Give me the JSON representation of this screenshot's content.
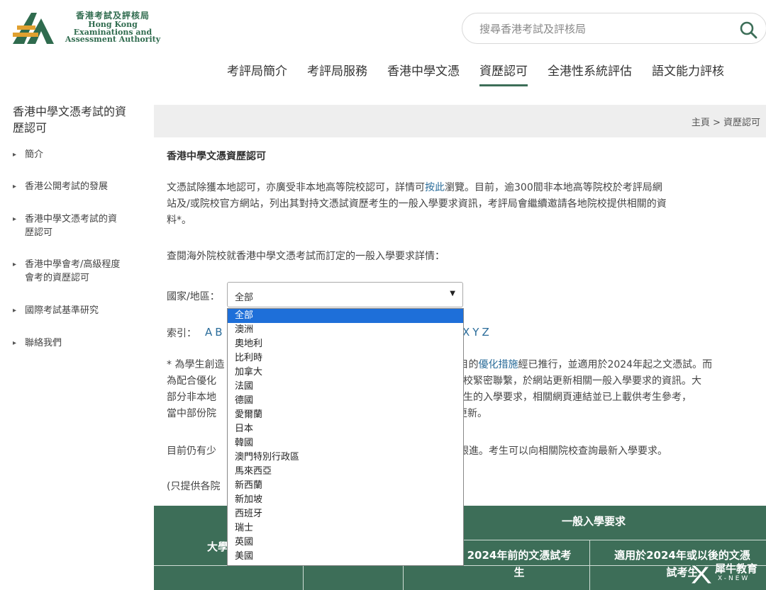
{
  "header": {
    "logo_zh": "香港考試及評核局",
    "logo_en_line1": "Hong Kong",
    "logo_en_line2": "Examinations and",
    "logo_en_line3": "Assessment Authority",
    "search_placeholder": "搜尋香港考試及評核局"
  },
  "nav": [
    {
      "label": "考評局簡介",
      "active": false
    },
    {
      "label": "考評局服務",
      "active": false
    },
    {
      "label": "香港中學文憑",
      "active": false
    },
    {
      "label": "資歷認可",
      "active": true
    },
    {
      "label": "全港性系統評估",
      "active": false
    },
    {
      "label": "語文能力評核",
      "active": false
    }
  ],
  "sidebar": {
    "title_line1": "香港中學文憑考試的資",
    "title_line2": "歷認可",
    "items": [
      {
        "line1": "簡介",
        "line2": ""
      },
      {
        "line1": "香港公開考試的發展",
        "line2": ""
      },
      {
        "line1": "香港中學文憑考試的資",
        "line2": "歷認可"
      },
      {
        "line1": "香港中學會考/高級程度",
        "line2": "會考的資歷認可"
      },
      {
        "line1": "國際考試基準研究",
        "line2": ""
      },
      {
        "line1": "聯絡我們",
        "line2": ""
      }
    ]
  },
  "breadcrumb": "主頁 > 資歷認可",
  "content": {
    "title": "香港中學文憑資歷認可",
    "p1_line1_a": "文憑試除獲本地認可，亦廣受非本地高等院校認可，詳情可",
    "p1_link": "按此",
    "p1_line1_b": "瀏覽。目前，逾300間非本地高等院校於考評局網",
    "p1_line2": "站及/或院校官方網站，列出其對持文憑試資歷考生的一般入學要求資訊，考評局會繼續邀請各地院校提供相關的資",
    "p1_line3": "料*。",
    "p2": "查閱海外院校就香港中學文憑考試而訂定的一般入學要求詳情：",
    "region_label": "國家/地區：",
    "select_value": "全部",
    "index_label": "索引：",
    "index_letters_left": "AB",
    "index_letters_right": "XYZ",
    "p3_line1_a": "* 為學生創造",
    "p3_line1_b": "目的",
    "p3_link": "優化措施",
    "p3_line1_c": "經已推行，並適用於2024年起之文憑試。而",
    "p3_line2_a": "為配合優化",
    "p3_line2_b": "院校緊密聯繫，於網站更新相關一般入學要求的資訊。大",
    "p3_line3_a": "部分非本地",
    "p3_line3_b": "試考生的入學要求，相關網頁連結並已上載供考生參考，",
    "p3_line4_a": "當中部份院",
    "p3_line4_b": "更新。",
    "p4_a": "目前仍有少",
    "p4_b": "續跟進。考生可以向相關院校查詢最新入學要求。",
    "p5": "(只提供各院"
  },
  "dropdown_options": [
    "全部",
    "澳洲",
    "奧地利",
    "比利時",
    "加拿大",
    "法國",
    "德國",
    "愛爾蘭",
    "日本",
    "韓國",
    "澳門特別行政區",
    "馬來西亞",
    "新西蘭",
    "新加坡",
    "西班牙",
    "瑞士",
    "英國",
    "美國"
  ],
  "table": {
    "header_main": "一般入學要求",
    "col_left": "大學",
    "col_mid_line1": "2024年前的文憑試考",
    "col_mid_line2": "生",
    "col_right_line1": "適用於2024年或以後的文憑",
    "col_right_line2": "試考生"
  },
  "watermark": {
    "text": "犀牛教育",
    "sub": "X-NEW"
  },
  "colors": {
    "brand_green": "#3d6e58",
    "link_blue": "#2a6c9a",
    "selected_blue": "#1e6fd9"
  }
}
